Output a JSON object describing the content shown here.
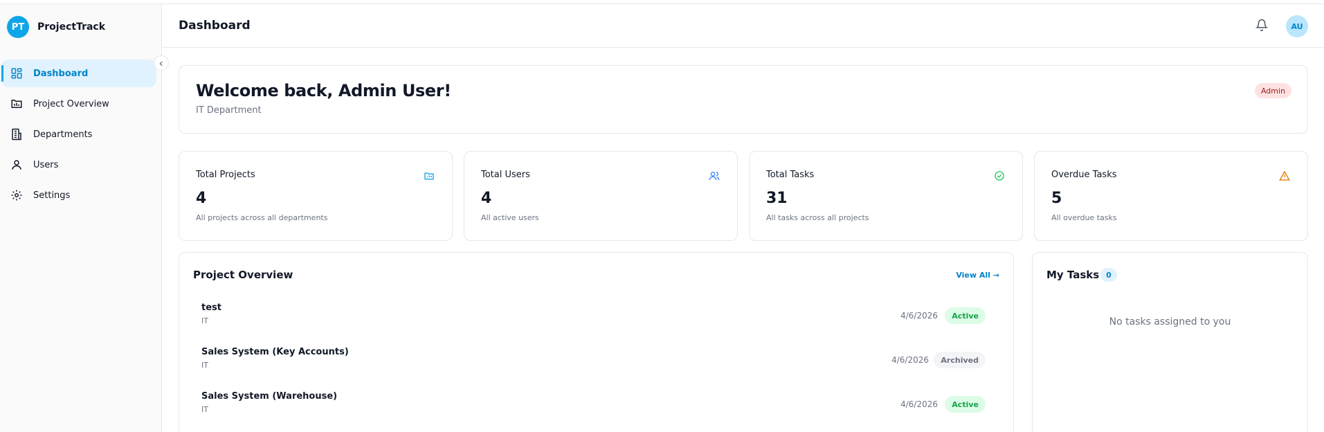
{
  "app": {
    "logo_initials": "PT",
    "name": "ProjectTrack"
  },
  "sidebar": {
    "items": [
      {
        "label": "Dashboard",
        "icon": "dashboard-grid-icon",
        "active": true
      },
      {
        "label": "Project Overview",
        "icon": "project-chart-icon",
        "active": false
      },
      {
        "label": "Departments",
        "icon": "building-icon",
        "active": false
      },
      {
        "label": "Users",
        "icon": "user-icon",
        "active": false
      },
      {
        "label": "Settings",
        "icon": "gear-icon",
        "active": false
      }
    ]
  },
  "header": {
    "title": "Dashboard",
    "avatar_initials": "AU"
  },
  "welcome": {
    "title": "Welcome back, Admin User!",
    "subtitle": "IT Department",
    "role": "Admin"
  },
  "stats": [
    {
      "label": "Total Projects",
      "value": "4",
      "desc": "All projects across all departments",
      "icon": "folder-icon",
      "color": "#0ea5e9"
    },
    {
      "label": "Total Users",
      "value": "4",
      "desc": "All active users",
      "icon": "users-icon",
      "color": "#3b82f6"
    },
    {
      "label": "Total Tasks",
      "value": "31",
      "desc": "All tasks across all projects",
      "icon": "check-circle-icon",
      "color": "#22c55e"
    },
    {
      "label": "Overdue Tasks",
      "value": "5",
      "desc": "All overdue tasks",
      "icon": "warning-icon",
      "color": "#d97706"
    }
  ],
  "projects": {
    "title": "Project Overview",
    "view_all": "View All →",
    "rows": [
      {
        "name": "test",
        "dept": "IT",
        "date": "4/6/2026",
        "status": "Active"
      },
      {
        "name": "Sales System (Key Accounts)",
        "dept": "IT",
        "date": "4/6/2026",
        "status": "Archived"
      },
      {
        "name": "Sales System (Warehouse)",
        "dept": "IT",
        "date": "4/6/2026",
        "status": "Active"
      }
    ]
  },
  "my_tasks": {
    "title": "My Tasks",
    "count": "0",
    "empty_message": "No tasks assigned to you"
  }
}
